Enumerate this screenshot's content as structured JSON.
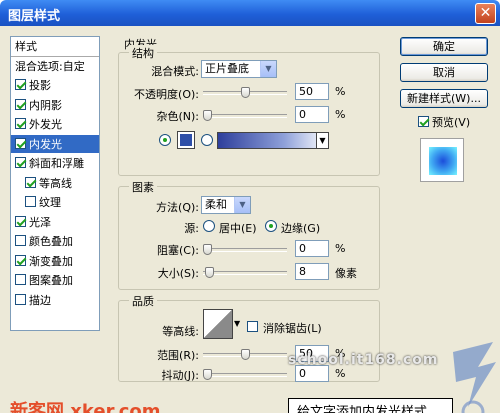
{
  "window": {
    "title": "图层样式",
    "close_glyph": "✕"
  },
  "style_list": {
    "header": "样式",
    "items": [
      {
        "label": "混合选项:自定",
        "checkbox": false,
        "checked": false,
        "selected": false,
        "indent": false
      },
      {
        "label": "投影",
        "checkbox": true,
        "checked": true,
        "selected": false,
        "indent": false
      },
      {
        "label": "内阴影",
        "checkbox": true,
        "checked": true,
        "selected": false,
        "indent": false
      },
      {
        "label": "外发光",
        "checkbox": true,
        "checked": true,
        "selected": false,
        "indent": false
      },
      {
        "label": "内发光",
        "checkbox": true,
        "checked": true,
        "selected": true,
        "indent": false
      },
      {
        "label": "斜面和浮雕",
        "checkbox": true,
        "checked": true,
        "selected": false,
        "indent": false
      },
      {
        "label": "等高线",
        "checkbox": true,
        "checked": true,
        "selected": false,
        "indent": true
      },
      {
        "label": "纹理",
        "checkbox": true,
        "checked": false,
        "selected": false,
        "indent": true
      },
      {
        "label": "光泽",
        "checkbox": true,
        "checked": true,
        "selected": false,
        "indent": false
      },
      {
        "label": "颜色叠加",
        "checkbox": true,
        "checked": false,
        "selected": false,
        "indent": false
      },
      {
        "label": "渐变叠加",
        "checkbox": true,
        "checked": true,
        "selected": false,
        "indent": false
      },
      {
        "label": "图案叠加",
        "checkbox": true,
        "checked": false,
        "selected": false,
        "indent": false
      },
      {
        "label": "描边",
        "checkbox": true,
        "checked": false,
        "selected": false,
        "indent": false
      }
    ]
  },
  "inner_glow": {
    "title": "内发光",
    "structure": {
      "title": "结构",
      "blend_mode_label": "混合模式:",
      "blend_mode_value": "正片叠底",
      "opacity_label": "不透明度(O):",
      "opacity_value": "50",
      "opacity_unit": "%",
      "opacity_percent": 50,
      "noise_label": "杂色(N):",
      "noise_value": "0",
      "noise_unit": "%",
      "noise_percent": 0,
      "swatch_color": "#2e4fa8"
    },
    "elements": {
      "title": "图素",
      "technique_label": "方法(Q):",
      "technique_value": "柔和",
      "source_label": "源:",
      "source_center_label": "居中(E)",
      "source_edge_label": "边缘(G)",
      "choke_label": "阻塞(C):",
      "choke_value": "0",
      "choke_unit": "%",
      "choke_percent": 0,
      "size_label": "大小(S):",
      "size_value": "8",
      "size_unit": "像素",
      "size_percent": 3
    },
    "quality": {
      "title": "品质",
      "contour_label": "等高线:",
      "anti_alias_label": "消除锯齿(L)",
      "range_label": "范围(R):",
      "range_value": "50",
      "range_unit": "%",
      "range_percent": 50,
      "jitter_label": "抖动(J):",
      "jitter_value": "0",
      "jitter_unit": "%",
      "jitter_percent": 0
    }
  },
  "buttons": {
    "ok": "确定",
    "cancel": "取消",
    "new_style": "新建样式(W)...",
    "preview_label": "预览(V)"
  },
  "overlay": {
    "url_text": "school.it168.com",
    "watermark": "新客网 xker.com",
    "caption": "给文字添加内发光样式"
  },
  "colors": {
    "accent": "#316ac5",
    "titlebar": "#1f5fd8",
    "dialog_bg": "#ece9d8",
    "watermark": "#e44f2b"
  }
}
